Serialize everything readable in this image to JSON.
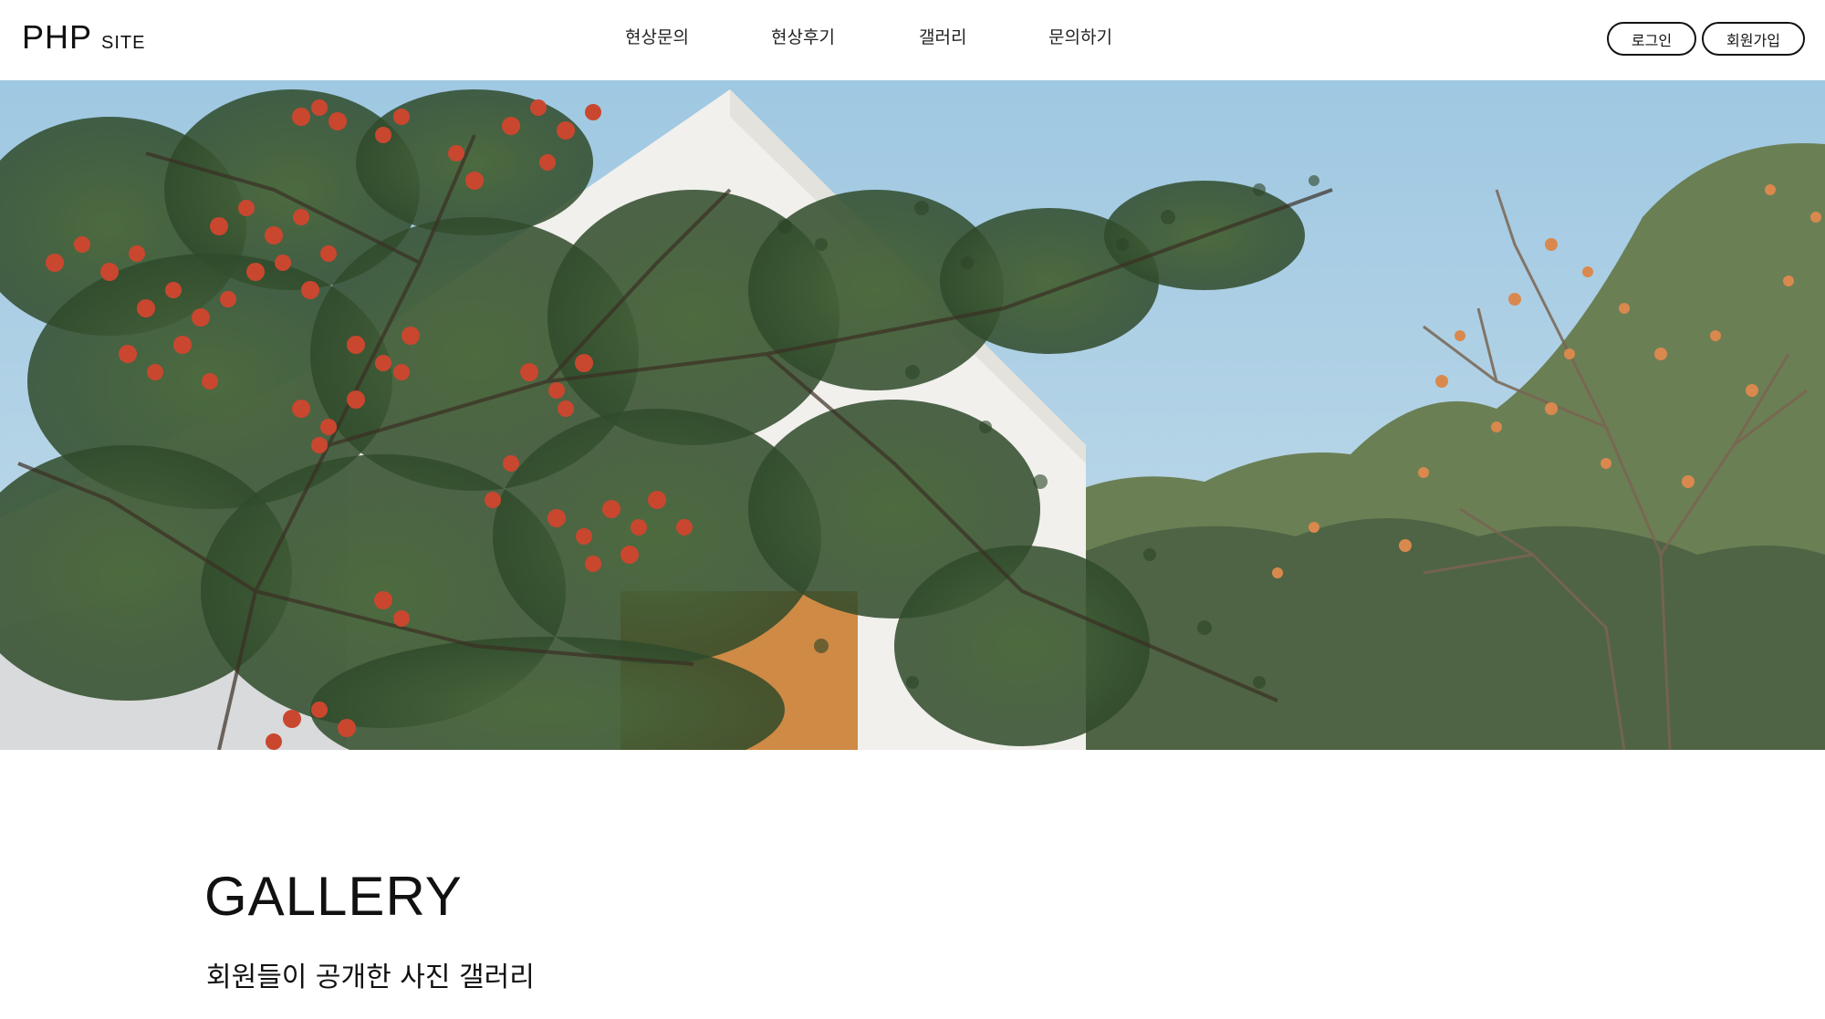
{
  "header": {
    "logo_main": "PHP",
    "logo_sub": "SITE",
    "nav": [
      "현상문의",
      "현상후기",
      "갤러리",
      "문의하기"
    ],
    "login_label": "로그인",
    "signup_label": "회원가입"
  },
  "hero": {
    "image_alt": "hero-photo"
  },
  "main": {
    "title": "GALLERY",
    "subtitle": "회원들이 공개한 사진 갤러리"
  },
  "colors": {
    "sky": "#a9cde3",
    "house_wall": "#f1f0ec",
    "foliage": "#3f5e36",
    "berries": "#c9472f",
    "persimmon": "#d88a4f",
    "text": "#111111"
  }
}
